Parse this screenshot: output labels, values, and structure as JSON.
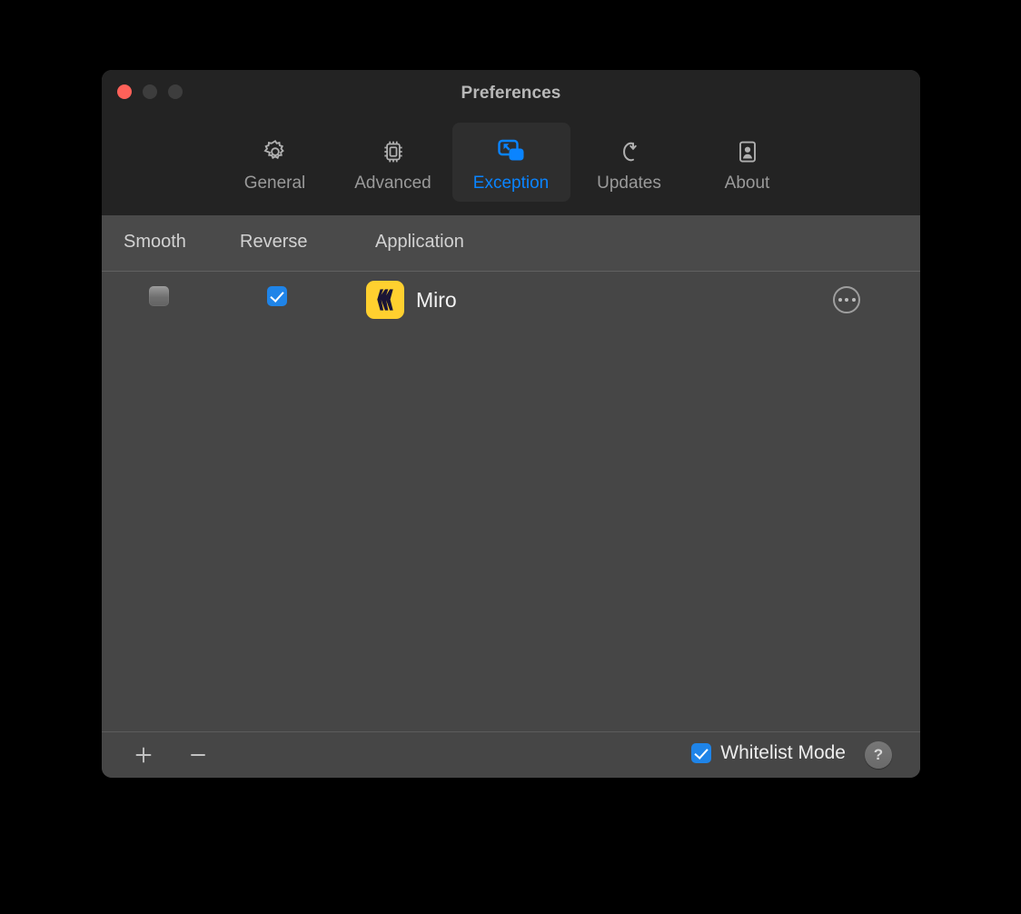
{
  "window": {
    "title": "Preferences",
    "controls": {
      "close": "close-button",
      "minimize": "minimize-button",
      "zoom": "zoom-button"
    },
    "accent_color": "#0a84ff",
    "titlebar_color": "#232323",
    "body_color": "#464646"
  },
  "tabs": [
    {
      "id": "general",
      "label": "General",
      "icon": "gear-icon",
      "selected": false
    },
    {
      "id": "advanced",
      "label": "Advanced",
      "icon": "chip-icon",
      "selected": false
    },
    {
      "id": "exception",
      "label": "Exception",
      "icon": "windows-cursor-icon",
      "selected": true
    },
    {
      "id": "updates",
      "label": "Updates",
      "icon": "refresh-icon",
      "selected": false
    },
    {
      "id": "about",
      "label": "About",
      "icon": "person-card-icon",
      "selected": false
    }
  ],
  "table": {
    "columns": [
      {
        "id": "smooth",
        "label": "Smooth"
      },
      {
        "id": "reverse",
        "label": "Reverse"
      },
      {
        "id": "application",
        "label": "Application"
      }
    ],
    "rows": [
      {
        "app_name": "Miro",
        "app_icon": "miro-app-icon",
        "app_icon_bg": "#ffd02f",
        "app_icon_fg": "#1a1535",
        "smooth": false,
        "reverse": true,
        "more": "⋯"
      }
    ]
  },
  "bottom_bar": {
    "add_label": "+",
    "remove_label": "−",
    "whitelist_label": "Whitelist Mode",
    "whitelist_checked": true,
    "help_label": "?"
  }
}
